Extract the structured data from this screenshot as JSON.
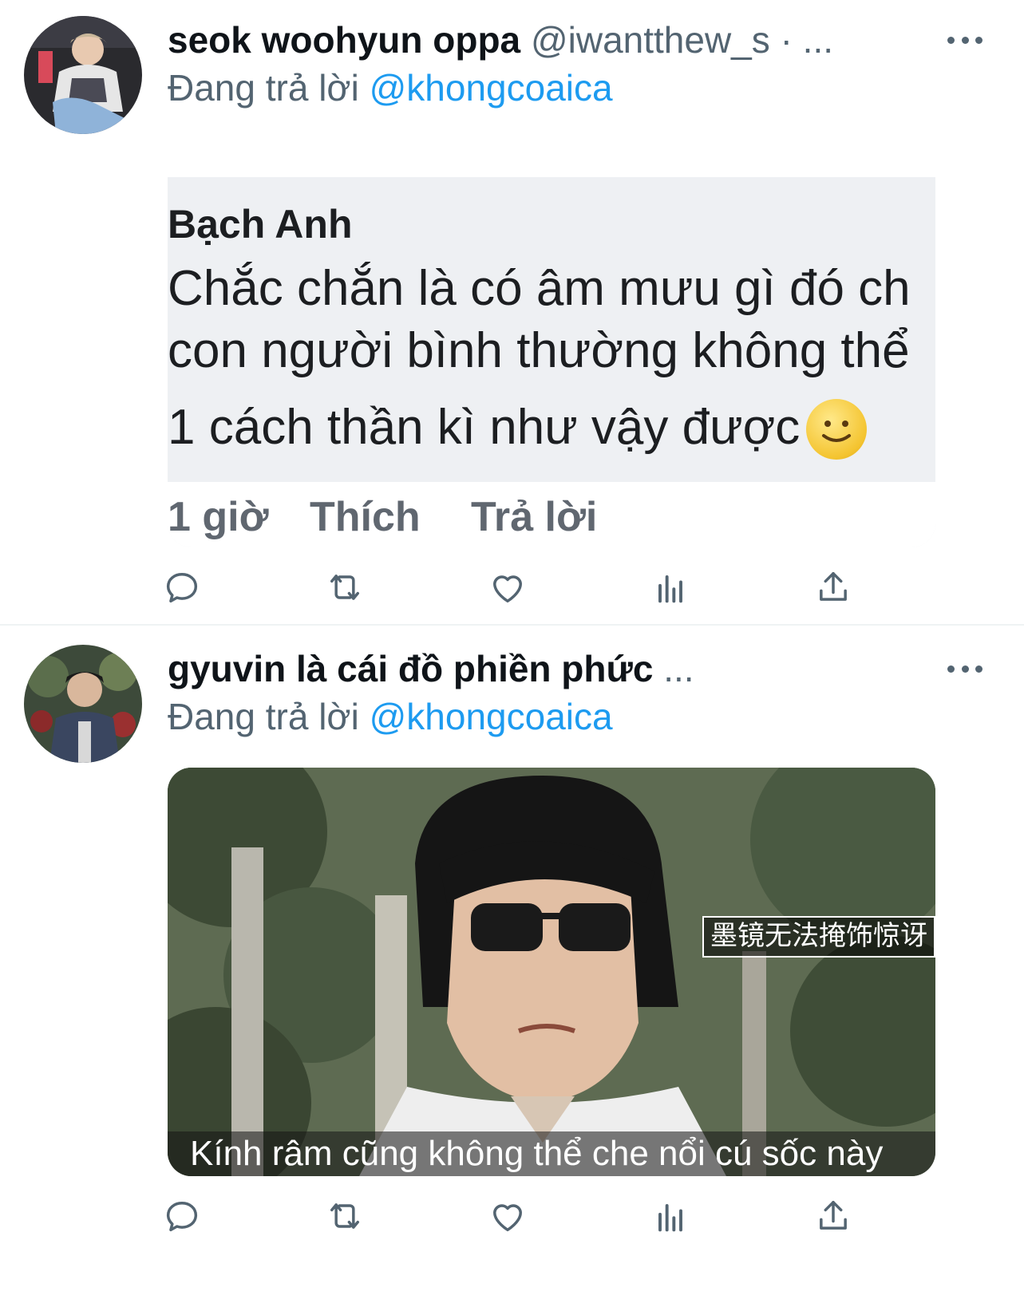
{
  "tweets": [
    {
      "name": "seok woohyun oppa",
      "handle": "@iwantthew_s",
      "separator": "·",
      "truncation": "...",
      "reply_prefix": "Đang trả lời",
      "reply_mention": "@khongcoaica",
      "media": {
        "type": "comment-screenshot",
        "author": "Bạch Anh",
        "lines": [
          "Chắc chắn là có âm mưu gì đó ch",
          "con người bình thường không thể",
          "1 cách thần kì như vậy được"
        ],
        "footer": {
          "time": "1 giờ",
          "like": "Thích",
          "reply": "Trả lời"
        }
      }
    },
    {
      "name": "gyuvin là cái đồ phiền phức",
      "truncation": "...",
      "reply_prefix": "Đang trả lời",
      "reply_mention": "@khongcoaica",
      "media": {
        "type": "meme-still",
        "caption_cn": "墨镜无法掩饰惊讶",
        "subtitle": "Kính râm cũng không thể che nổi cú sốc này"
      }
    }
  ],
  "actions": [
    "reply-icon",
    "retweet-icon",
    "like-icon",
    "analytics-icon",
    "share-icon"
  ],
  "colors": {
    "accent": "#1d9bf0",
    "secondary_text": "#536471",
    "primary_text": "#0f1419"
  }
}
